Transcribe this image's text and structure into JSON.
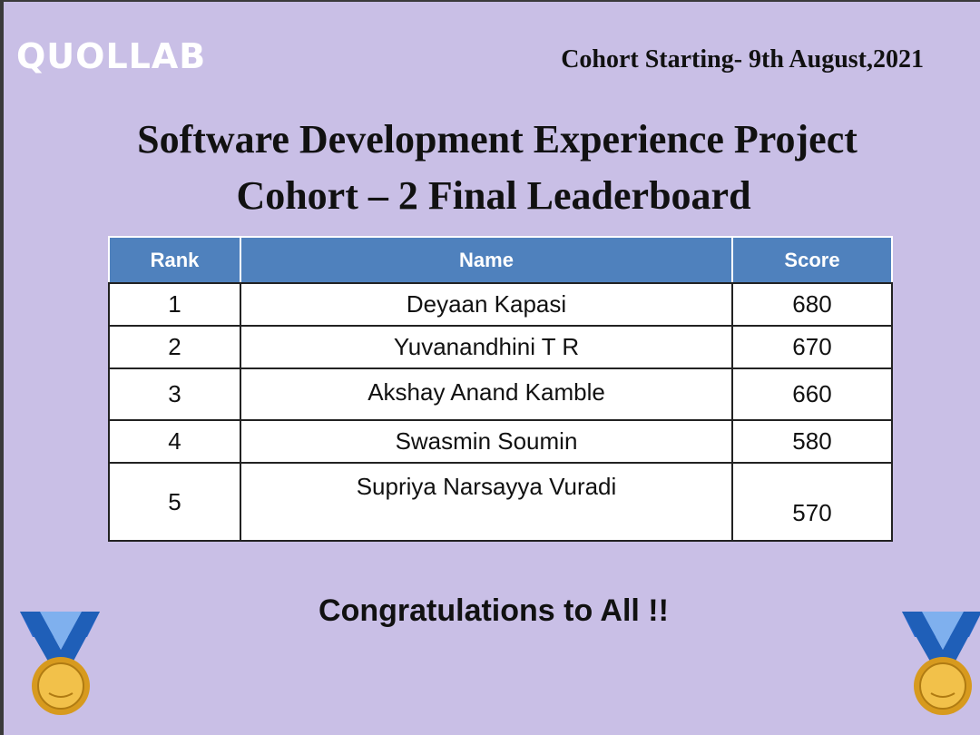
{
  "header": {
    "logo_text": "QUOLLAB",
    "cohort_start": "Cohort Starting- 9th August,2021"
  },
  "title": {
    "line1": "Software Development Experience Project",
    "line2": "Cohort – 2  Final Leaderboard"
  },
  "table": {
    "columns": [
      "Rank",
      "Name",
      "Score"
    ],
    "rows": [
      {
        "rank": "1",
        "name": "Deyaan Kapasi",
        "score": "680"
      },
      {
        "rank": "2",
        "name": "Yuvanandhini T R",
        "score": "670"
      },
      {
        "rank": "3",
        "name": "Akshay Anand Kamble",
        "score": "660"
      },
      {
        "rank": "4",
        "name": "Swasmin Soumin",
        "score": "580"
      },
      {
        "rank": "5",
        "name": "Supriya Narsayya Vuradi",
        "score": "570"
      }
    ]
  },
  "footer": {
    "congrats": "Congratulations to All !!"
  },
  "colors": {
    "background": "#c9bfe6",
    "header_blue": "#4f81bd",
    "medal_gold": "#e3a826",
    "ribbon_blue": "#1f5fb8"
  }
}
